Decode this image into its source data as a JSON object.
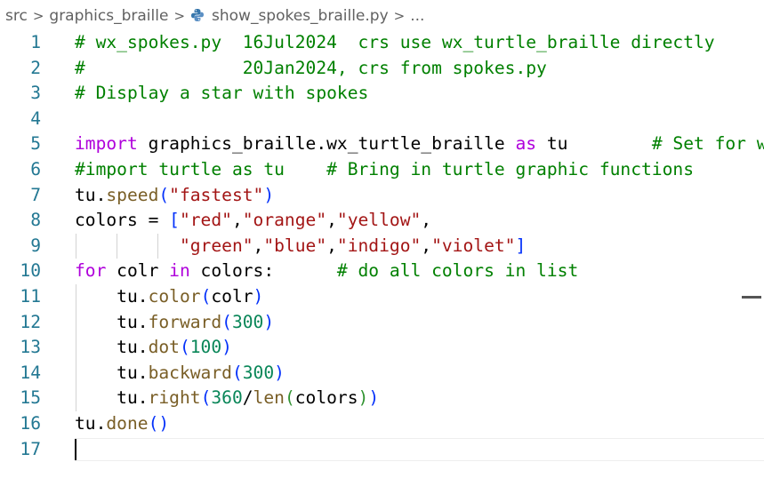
{
  "breadcrumb": {
    "items": [
      "src",
      "graphics_braille",
      "show_spokes_braille.py",
      "..."
    ],
    "separator": ">"
  },
  "editor": {
    "cursor_line": 17,
    "lines": [
      {
        "num": "1",
        "tokens": [
          {
            "t": "# wx_spokes.py  16Jul2024  crs use wx_turtle_braille directly",
            "c": "comment"
          }
        ]
      },
      {
        "num": "2",
        "tokens": [
          {
            "t": "#               20Jan2024, crs from spokes.py",
            "c": "comment"
          }
        ]
      },
      {
        "num": "3",
        "tokens": [
          {
            "t": "# Display a star with spokes",
            "c": "comment"
          }
        ]
      },
      {
        "num": "4",
        "tokens": []
      },
      {
        "num": "5",
        "tokens": [
          {
            "t": "import",
            "c": "keyword"
          },
          {
            "t": " graphics_braille.wx_turtle_braille ",
            "c": "plain"
          },
          {
            "t": "as",
            "c": "keyword"
          },
          {
            "t": " tu        ",
            "c": "plain"
          },
          {
            "t": "# Set for wx",
            "c": "comment"
          }
        ]
      },
      {
        "num": "6",
        "tokens": [
          {
            "t": "#import turtle as tu    # Bring in turtle graphic functions",
            "c": "comment"
          }
        ]
      },
      {
        "num": "7",
        "tokens": [
          {
            "t": "tu.",
            "c": "plain"
          },
          {
            "t": "speed",
            "c": "func"
          },
          {
            "t": "(",
            "c": "paren1"
          },
          {
            "t": "\"fastest\"",
            "c": "string"
          },
          {
            "t": ")",
            "c": "paren1"
          }
        ]
      },
      {
        "num": "8",
        "tokens": [
          {
            "t": "colors = ",
            "c": "plain"
          },
          {
            "t": "[",
            "c": "paren1"
          },
          {
            "t": "\"red\"",
            "c": "string"
          },
          {
            "t": ",",
            "c": "plain"
          },
          {
            "t": "\"orange\"",
            "c": "string"
          },
          {
            "t": ",",
            "c": "plain"
          },
          {
            "t": "\"yellow\"",
            "c": "string"
          },
          {
            "t": ",",
            "c": "plain"
          }
        ]
      },
      {
        "num": "9",
        "tokens": [
          {
            "t": "          ",
            "c": "plain"
          },
          {
            "t": "\"green\"",
            "c": "string"
          },
          {
            "t": ",",
            "c": "plain"
          },
          {
            "t": "\"blue\"",
            "c": "string"
          },
          {
            "t": ",",
            "c": "plain"
          },
          {
            "t": "\"indigo\"",
            "c": "string"
          },
          {
            "t": ",",
            "c": "plain"
          },
          {
            "t": "\"violet\"",
            "c": "string"
          },
          {
            "t": "]",
            "c": "paren1"
          }
        ]
      },
      {
        "num": "10",
        "tokens": [
          {
            "t": "for",
            "c": "keyword"
          },
          {
            "t": " colr ",
            "c": "plain"
          },
          {
            "t": "in",
            "c": "keyword"
          },
          {
            "t": " colors:      ",
            "c": "plain"
          },
          {
            "t": "# do all colors in list",
            "c": "comment"
          }
        ]
      },
      {
        "num": "11",
        "tokens": [
          {
            "t": "    tu.",
            "c": "plain"
          },
          {
            "t": "color",
            "c": "func"
          },
          {
            "t": "(",
            "c": "paren1"
          },
          {
            "t": "colr",
            "c": "plain"
          },
          {
            "t": ")",
            "c": "paren1"
          }
        ]
      },
      {
        "num": "12",
        "tokens": [
          {
            "t": "    tu.",
            "c": "plain"
          },
          {
            "t": "forward",
            "c": "func"
          },
          {
            "t": "(",
            "c": "paren1"
          },
          {
            "t": "300",
            "c": "number"
          },
          {
            "t": ")",
            "c": "paren1"
          }
        ]
      },
      {
        "num": "13",
        "tokens": [
          {
            "t": "    tu.",
            "c": "plain"
          },
          {
            "t": "dot",
            "c": "func"
          },
          {
            "t": "(",
            "c": "paren1"
          },
          {
            "t": "100",
            "c": "number"
          },
          {
            "t": ")",
            "c": "paren1"
          }
        ]
      },
      {
        "num": "14",
        "tokens": [
          {
            "t": "    tu.",
            "c": "plain"
          },
          {
            "t": "backward",
            "c": "func"
          },
          {
            "t": "(",
            "c": "paren1"
          },
          {
            "t": "300",
            "c": "number"
          },
          {
            "t": ")",
            "c": "paren1"
          }
        ]
      },
      {
        "num": "15",
        "tokens": [
          {
            "t": "    tu.",
            "c": "plain"
          },
          {
            "t": "right",
            "c": "func"
          },
          {
            "t": "(",
            "c": "paren1"
          },
          {
            "t": "360",
            "c": "number"
          },
          {
            "t": "/",
            "c": "plain"
          },
          {
            "t": "len",
            "c": "func"
          },
          {
            "t": "(",
            "c": "paren2"
          },
          {
            "t": "colors",
            "c": "plain"
          },
          {
            "t": ")",
            "c": "paren2"
          },
          {
            "t": ")",
            "c": "paren1"
          }
        ]
      },
      {
        "num": "16",
        "tokens": [
          {
            "t": "tu.",
            "c": "plain"
          },
          {
            "t": "done",
            "c": "func"
          },
          {
            "t": "(",
            "c": "paren1"
          },
          {
            "t": ")",
            "c": "paren1"
          }
        ]
      },
      {
        "num": "17",
        "tokens": []
      }
    ]
  },
  "colors": {
    "comment": "#008000",
    "keyword": "#af00db",
    "string": "#a31515",
    "number": "#098658",
    "function": "#795e26",
    "line_number": "#237893",
    "bracket": "#0431fa"
  },
  "icons": {
    "breadcrumb_file": "python-file-icon",
    "separator": "chevron-right-icon"
  }
}
